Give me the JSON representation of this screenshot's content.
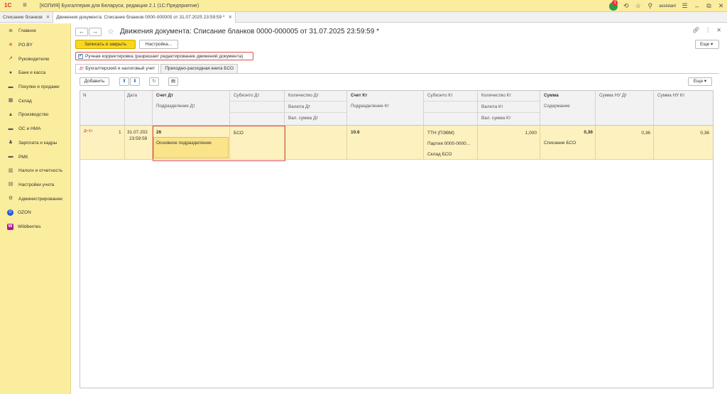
{
  "app": {
    "logo": "1С",
    "title": "[КОПИЯ] Бухгалтерия для Беларуси, редакция 2.1  (1С:Предприятие)",
    "notification_count": "1",
    "username": "assistant"
  },
  "tabs": [
    {
      "label": "Списание бланков"
    },
    {
      "label": "Движения документа: Списание бланков 0000-000005 от 31.07.2025 23:59:59 *"
    }
  ],
  "sidebar": {
    "items": [
      {
        "label": "Главное",
        "icon": "≣"
      },
      {
        "label": "PO.BY",
        "icon": "✳"
      },
      {
        "label": "Руководителю",
        "icon": "↗"
      },
      {
        "label": "Банк и касса",
        "icon": "●"
      },
      {
        "label": "Покупки и продажи",
        "icon": "▬"
      },
      {
        "label": "Склад",
        "icon": "▦"
      },
      {
        "label": "Производство",
        "icon": "▲"
      },
      {
        "label": "ОС и НМА",
        "icon": "▬"
      },
      {
        "label": "Зарплата и кадры",
        "icon": "♟"
      },
      {
        "label": "РМК",
        "icon": "▬"
      },
      {
        "label": "Налоги и отчетность",
        "icon": "▥"
      },
      {
        "label": "Настройки учета",
        "icon": "▤"
      },
      {
        "label": "Администрирование",
        "icon": "⚙"
      },
      {
        "label": "OZON",
        "icon": "O"
      },
      {
        "label": "Wildberries",
        "icon": "W"
      }
    ]
  },
  "page": {
    "back": "←",
    "forward": "→",
    "title": "Движения документа: Списание бланков 0000-000005 от 31.07.2025 23:59:59 *",
    "save_close": "Записать и закрыть",
    "settings": "Настройка...",
    "more": "Еще",
    "manual_correction": "Ручная корректировка (разрешает редактирование движений документа)",
    "subtabs": [
      "Бухгалтерский и налоговый учет",
      "Приходно-расходная книга БСО"
    ],
    "add": "Добавить",
    "more2": "Еще"
  },
  "table": {
    "headers": {
      "n": "N",
      "date": "Дата",
      "account_dt": "Счет Дт",
      "dept_dt": "Подразделение Дт",
      "subconto_dt": "Субконто Дт",
      "qty_dt": "Количество Дт",
      "currency_dt": "Валюта Дт",
      "cur_sum_dt": "Вал. сумма Дт",
      "account_kt": "Счет Кт",
      "dept_kt": "Подразделение Кт",
      "subconto_kt": "Субконто Кт",
      "qty_kt": "Количество Кт",
      "currency_kt": "Валюта Кт",
      "cur_sum_kt": "Вал. сумма Кт",
      "sum": "Сумма",
      "content": "Содержание",
      "sum_nu_dt": "Сумма НУ Дт",
      "sum_nu_kt": "Сумма НУ Кт"
    },
    "row": {
      "icon": "Дт Кт",
      "n": "1",
      "date_line1": "31.07.202",
      "date_line2": "23:59:59",
      "account_dt": "26",
      "dept_dt": "Основное подразделение",
      "subconto_dt": "БСО",
      "account_kt": "10.6",
      "subconto_kt_1": "ТТН (ПЭВМ)",
      "subconto_kt_2": "Партия 0000-0000...",
      "subconto_kt_3": "Склад БСО",
      "qty_kt": "1,000",
      "sum": "0,36",
      "content": "Списание БСО",
      "sum_nu_dt": "0,36",
      "sum_nu_kt": "0,36"
    }
  }
}
